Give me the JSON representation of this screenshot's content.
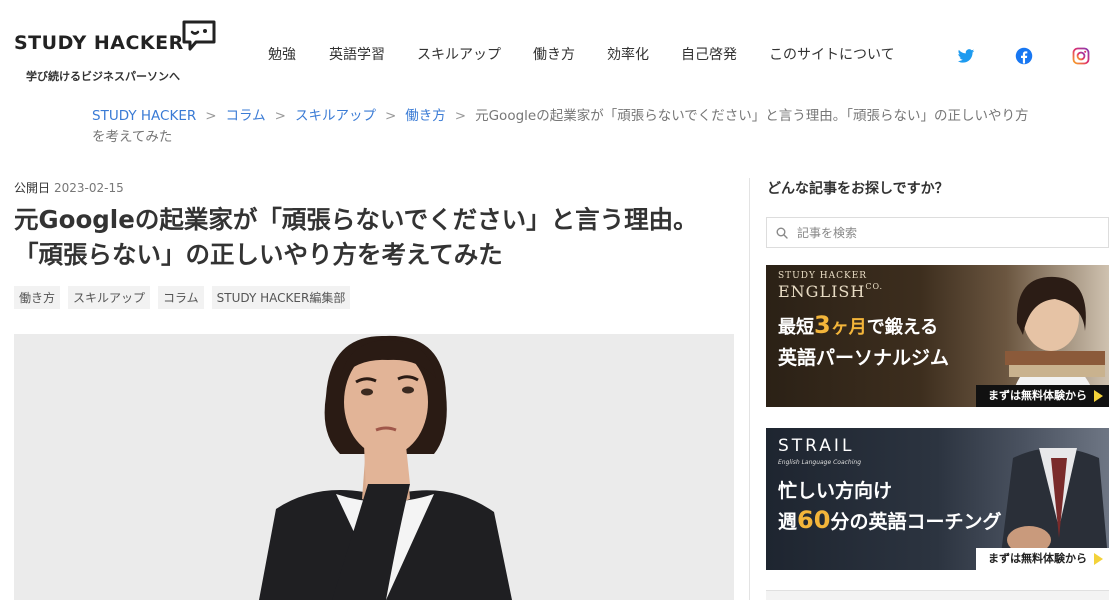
{
  "header": {
    "logo_text": "STUDY HACKER",
    "tagline": "学び続けるビジネスパーソンへ",
    "nav": [
      "勉強",
      "英語学習",
      "スキルアップ",
      "働き方",
      "効率化",
      "自己啓発",
      "このサイトについて"
    ],
    "social": [
      "twitter-icon",
      "facebook-icon",
      "instagram-icon"
    ]
  },
  "breadcrumb": {
    "items": [
      "STUDY HACKER",
      "コラム",
      "スキルアップ",
      "働き方"
    ],
    "separator": ">",
    "current": "元Googleの起業家が「頑張らないでください」と言う理由。「頑張らない」の正しいやり方を考えてみた"
  },
  "article": {
    "published_label": "公開日",
    "published_date": "2023-02-15",
    "title": "元Googleの起業家が「頑張らないでください」と言う理由。「頑張らない」の正しいやり方を考えてみた",
    "tags": [
      "働き方",
      "スキルアップ",
      "コラム",
      "STUDY HACKER編集部"
    ]
  },
  "sidebar": {
    "heading": "どんな記事をお探しですか？",
    "search_placeholder": "記事を検索",
    "banner1": {
      "brand_top": "STUDY HACKER",
      "brand": "ENGLISH",
      "brand_suffix": "CO.",
      "line1_pre": "最短",
      "line1_num": "3",
      "line1_mid": "ヶ月",
      "line1_post": "で鍛える",
      "line2": "英語パーソナルジム",
      "cta": "まずは無料体験から"
    },
    "banner2": {
      "brand": "STRAIL",
      "brand_sub": "English Language Coaching",
      "line1": "忙しい方向け",
      "line2_pre": "週",
      "line2_num": "60",
      "line2_mid": "分",
      "line2_post": "の英語コーチング",
      "cta": "まずは無料体験から"
    }
  },
  "colors": {
    "link": "#3a7bd5",
    "twitter": "#1d9bf0",
    "facebook": "#1877f2",
    "instagram": "#e1306c",
    "banner_accent": "#f3b53a"
  }
}
